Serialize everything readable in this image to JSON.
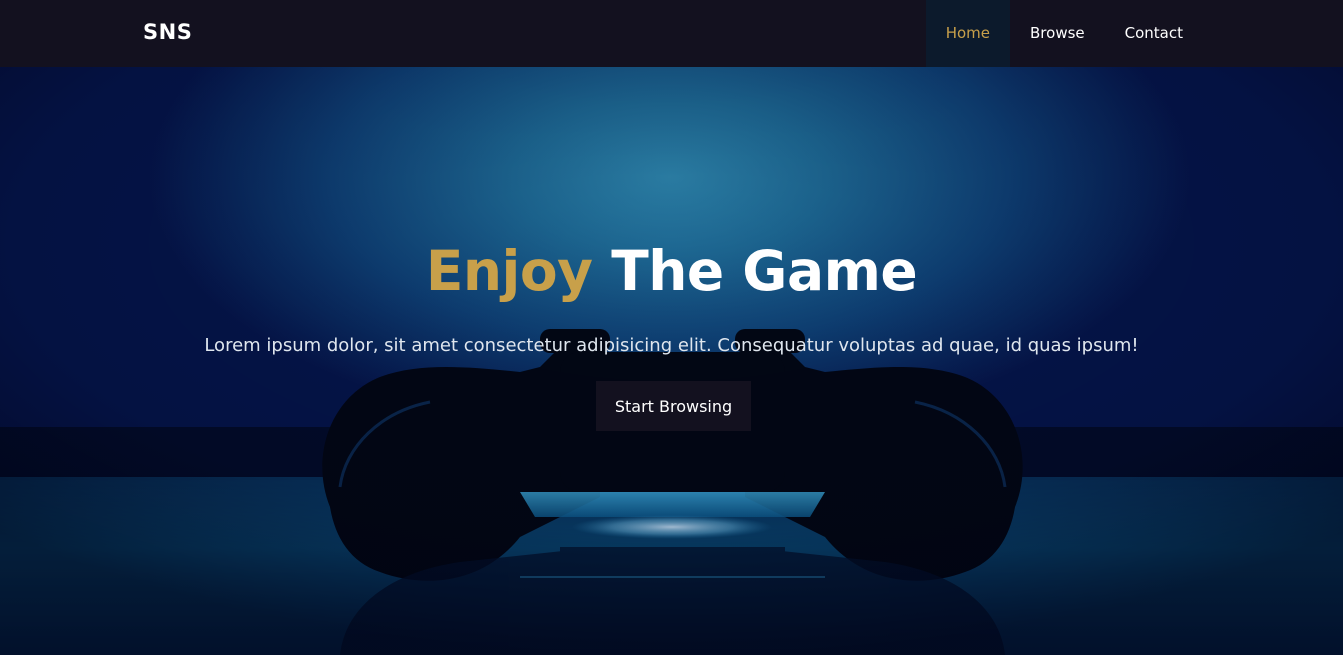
{
  "navbar": {
    "brand": "SNS",
    "links": [
      {
        "label": "Home",
        "active": true
      },
      {
        "label": "Browse",
        "active": false
      },
      {
        "label": "Contact",
        "active": false
      }
    ],
    "active_color": "#c8a04a",
    "background": "#13111f"
  },
  "hero": {
    "title_accent": "Enjoy",
    "title_rest": "The Game",
    "text": "Lorem ipsum dolor, sit amet consectetur adipisicing elit. Consequatur voluptas ad quae, id quas ipsum!",
    "button_label": "Start Browsing",
    "background_image": "gamepad-controller-photo",
    "accent_color": "#c8a04a"
  }
}
